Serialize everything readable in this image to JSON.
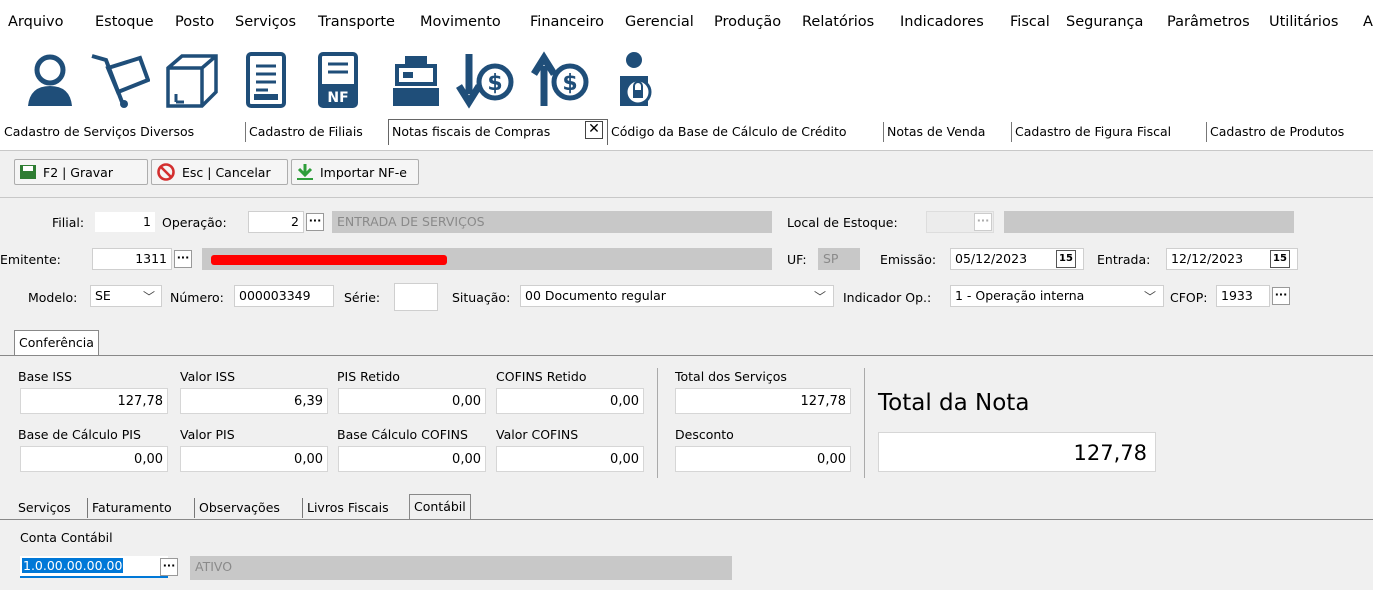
{
  "menu": [
    "Arquivo",
    "Estoque",
    "Posto",
    "Serviços",
    "Transporte",
    "Movimento",
    "Financeiro",
    "Gerencial",
    "Produção",
    "Relatórios",
    "Indicadores",
    "Fiscal",
    "Segurança",
    "Parâmetros",
    "Utilitários",
    "A"
  ],
  "tabs": [
    "Cadastro de Serviços Diversos",
    "Cadastro de Filiais",
    "Notas fiscais de Compras",
    "Código da Base de Cálculo de Crédito",
    "Notas de Venda",
    "Cadastro de Figura Fiscal",
    "Cadastro de Produtos"
  ],
  "close_glyph": "✕",
  "toolbar": {
    "save": "F2 | Gravar",
    "cancel": "Esc | Cancelar",
    "import": "Importar NF-e"
  },
  "form": {
    "filial_label": "Filial:",
    "filial_value": "1",
    "operacao_label": "Operação:",
    "operacao_value": "2",
    "operacao_desc": "ENTRADA DE SERVIÇOS",
    "local_label": "Local de Estoque:",
    "emitente_label": "Emitente:",
    "emitente_value": "1311",
    "uf_label": "UF:",
    "uf_value": "SP",
    "emissao_label": "Emissão:",
    "emissao_value": "05/12/2023",
    "entrada_label": "Entrada:",
    "entrada_value": "12/12/2023",
    "modelo_label": "Modelo:",
    "modelo_value": "SE",
    "numero_label": "Número:",
    "numero_value": "000003349",
    "serie_label": "Série:",
    "situacao_label": "Situação:",
    "situacao_value": "00 Documento regular",
    "indicador_label": "Indicador Op.:",
    "indicador_value": "1 - Operação interna",
    "cfop_label": "CFOP:",
    "cfop_value": "1933",
    "ellipsis": "···",
    "calendar": "15"
  },
  "conferencia": {
    "tab": "Conferência",
    "base_iss_label": "Base ISS",
    "base_iss": "127,78",
    "valor_iss_label": "Valor ISS",
    "valor_iss": "6,39",
    "pis_retido_label": "PIS Retido",
    "pis_retido": "0,00",
    "cofins_retido_label": "COFINS Retido",
    "cofins_retido": "0,00",
    "total_servicos_label": "Total dos Serviços",
    "total_servicos": "127,78",
    "base_pis_label": "Base de Cálculo PIS",
    "base_pis": "0,00",
    "valor_pis_label": "Valor PIS",
    "valor_pis": "0,00",
    "base_cofins_label": "Base Cálculo COFINS",
    "base_cofins": "0,00",
    "valor_cofins_label": "Valor COFINS",
    "valor_cofins": "0,00",
    "desconto_label": "Desconto",
    "desconto": "0,00",
    "total_nota_label": "Total da Nota",
    "total_nota": "127,78"
  },
  "bottom_tabs": [
    "Serviços",
    "Faturamento",
    "Observações",
    "Livros Fiscais",
    "Contábil"
  ],
  "contabil": {
    "label": "Conta Contábil",
    "value": "1.0.00.00.00.00",
    "desc": "ATIVO"
  },
  "colors": {
    "redaction": "#ff0000",
    "selection": "#0078d7"
  },
  "icons": [
    "user-icon",
    "cart-icon",
    "box-icon",
    "document-icon",
    "nfe-document-icon",
    "cash-register-icon",
    "money-in-icon",
    "money-out-icon",
    "lock-user-icon"
  ]
}
